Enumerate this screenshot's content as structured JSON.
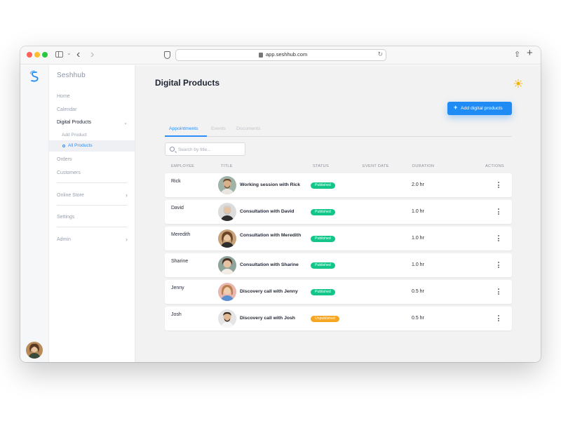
{
  "browser": {
    "url": "app.seshhub.com"
  },
  "brand": {
    "name": "Seshhub",
    "accent": "#1f8bf5"
  },
  "sidebar": {
    "items": [
      {
        "label": "Home"
      },
      {
        "label": "Calendar"
      },
      {
        "label": "Digital Products"
      },
      {
        "label": "Orders"
      },
      {
        "label": "Customers"
      },
      {
        "label": "Online Store"
      },
      {
        "label": "Settings"
      },
      {
        "label": "Admin"
      }
    ],
    "sub_items": [
      {
        "label": "Add Product"
      },
      {
        "label": "All Products"
      }
    ]
  },
  "main": {
    "title": "Digital Products",
    "add_button": "Add digital products",
    "tabs": [
      {
        "label": "Appointments"
      },
      {
        "label": "Events"
      },
      {
        "label": "Documents"
      }
    ],
    "search": {
      "placeholder": "Search by title..."
    },
    "columns": [
      "EMPLOYEE",
      "TITLE",
      "STATUS",
      "EVENT DATE",
      "DURATION",
      "ACTIONS"
    ],
    "rows": [
      {
        "employee": "Rick",
        "title": "Working session with Rick",
        "status": "Published",
        "event_date": "",
        "duration": "2.0 hr"
      },
      {
        "employee": "David",
        "title": "Consultation with David",
        "status": "Published",
        "event_date": "",
        "duration": "1.0 hr"
      },
      {
        "employee": "Meredith",
        "title": "Consultation with Meredith",
        "status": "Published",
        "event_date": "",
        "duration": "1.0 hr"
      },
      {
        "employee": "Sharine",
        "title": "Consultation with Sharine",
        "status": "Published",
        "event_date": "",
        "duration": "1.0 hr"
      },
      {
        "employee": "Jenny",
        "title": "Discovery call with Jenny",
        "status": "Published",
        "event_date": "",
        "duration": "0.5 hr"
      },
      {
        "employee": "Josh",
        "title": "Discovery call with Josh",
        "status": "Unpublished",
        "event_date": "",
        "duration": "0.5 hr"
      }
    ],
    "status_colors": {
      "published": "#14c58a",
      "unpublished": "#f5a623"
    }
  }
}
